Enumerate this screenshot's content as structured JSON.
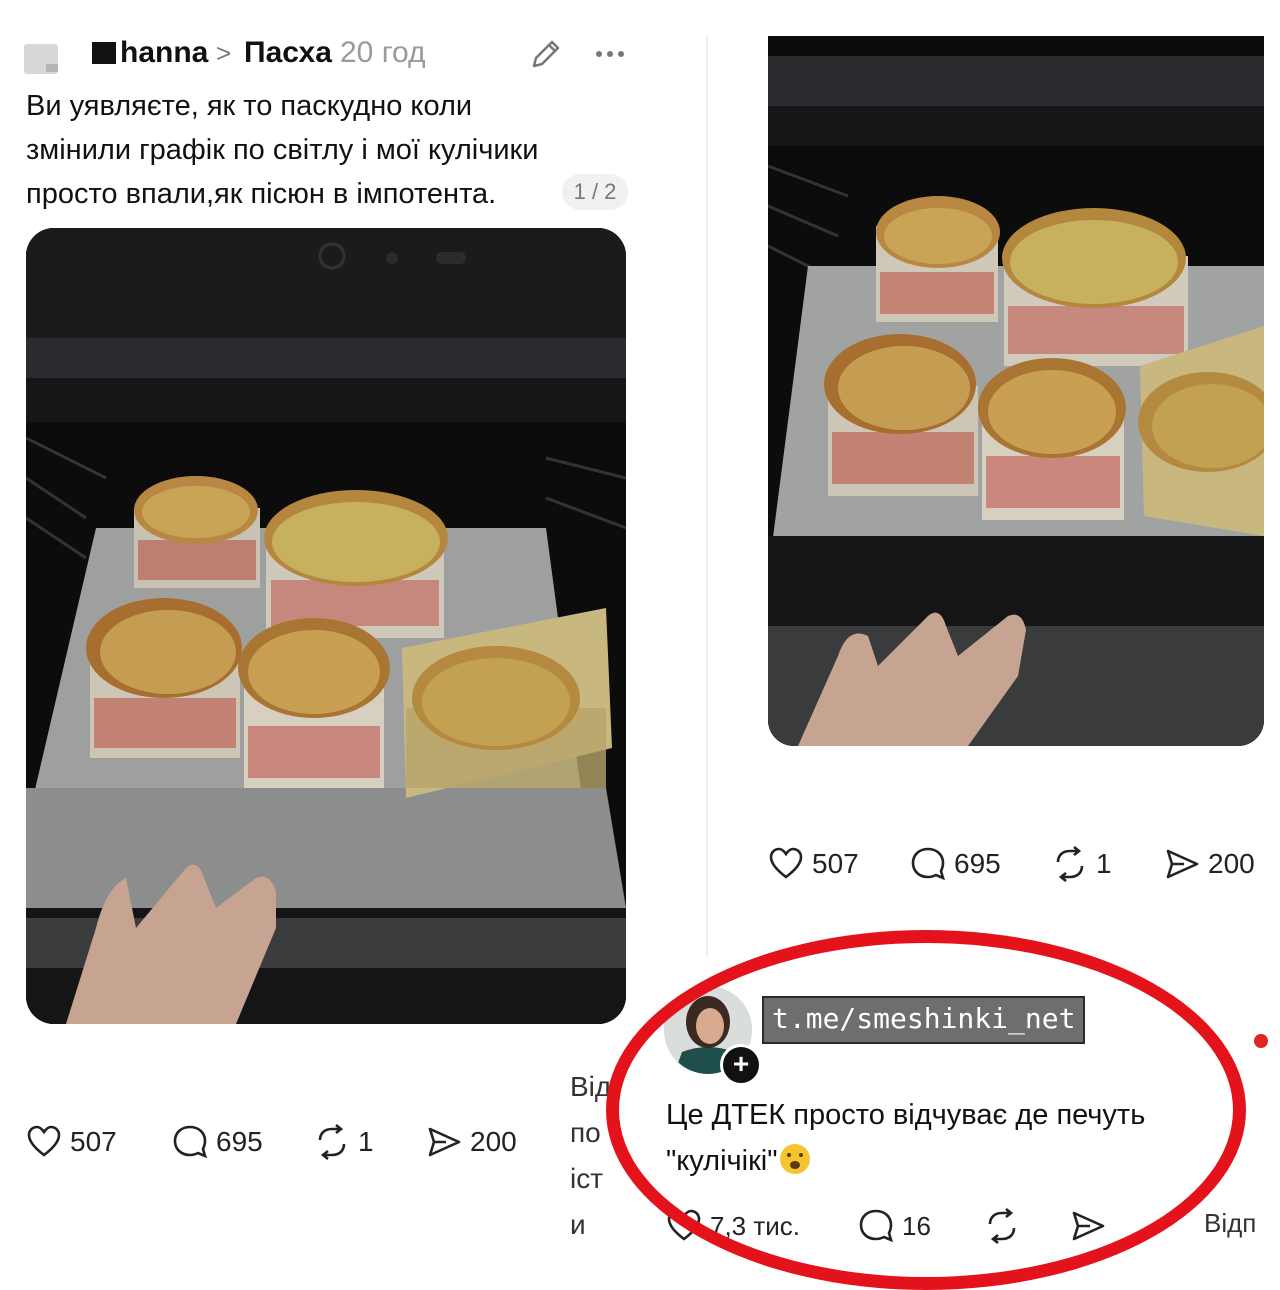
{
  "left_post": {
    "username": "hanna",
    "topic": "Пасха",
    "time": "20 год",
    "text_lines": [
      "Ви уявляєте, як то паскудно коли",
      "змінили графік по світлу і мої кулічики",
      "просто впали,як пісюн в імпотента."
    ],
    "page_indicator": "1 / 2",
    "likes": "507",
    "comments": "695",
    "reposts": "1",
    "shares": "200",
    "cut_text_lines": [
      "Від",
      "по",
      "іст",
      "и"
    ]
  },
  "right_post": {
    "likes": "507",
    "comments": "695",
    "reposts": "1",
    "shares": "200"
  },
  "comment": {
    "watermark": "t.me/smeshinki_net",
    "text_line1": "Це ДТЕК просто відчуває де печуть",
    "text_line2": "\"кулічікі\"",
    "likes": "7,3 тис.",
    "replies": "16",
    "reply_cut": "Відп",
    "plus": "+"
  },
  "colors": {
    "highlight_ellipse": "#e3121b",
    "muted": "#9a9a9a"
  },
  "icons": [
    "heart-icon",
    "comment-bubble-icon",
    "repost-icon",
    "share-icon",
    "edit-icon",
    "more-icon",
    "chevron-right-icon",
    "emoji-icon"
  ]
}
